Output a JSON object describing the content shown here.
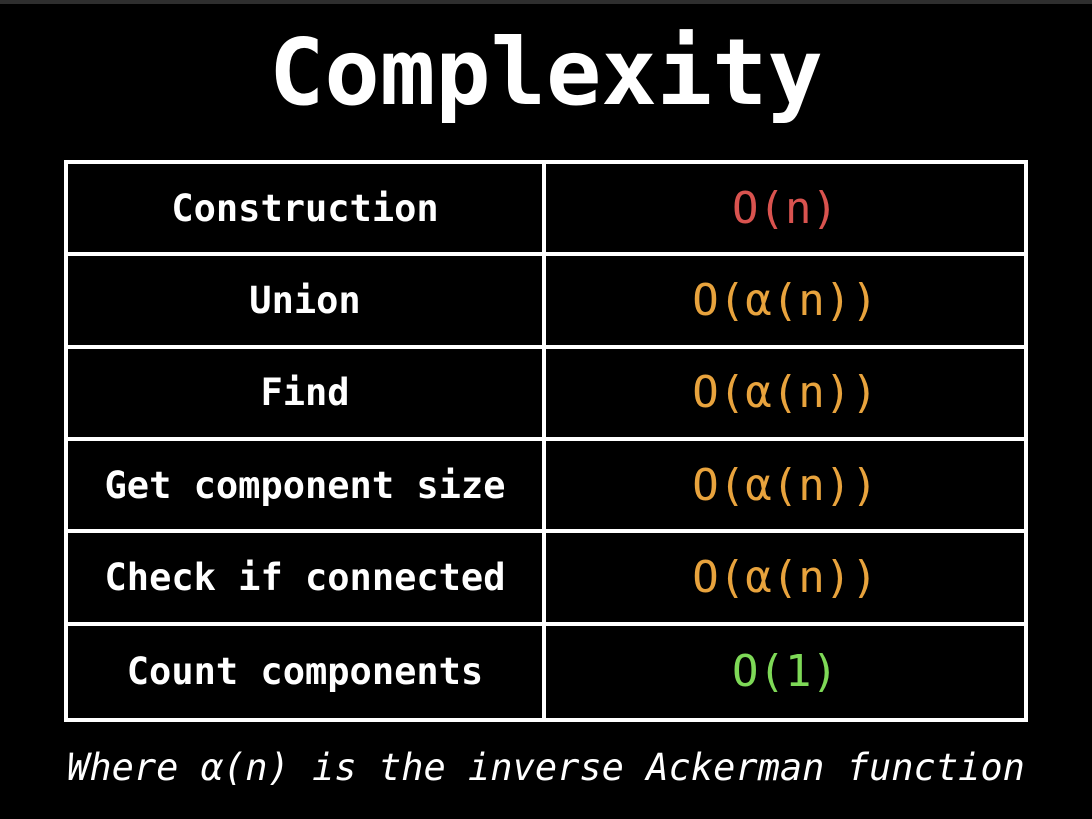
{
  "title": "Complexity",
  "rows": [
    {
      "operation": "Construction",
      "complexity": "O(n)",
      "color": "#d9534f"
    },
    {
      "operation": "Union",
      "complexity": "O(α(n))",
      "color": "#e8a33d"
    },
    {
      "operation": "Find",
      "complexity": "O(α(n))",
      "color": "#e8a33d"
    },
    {
      "operation": "Get component size",
      "complexity": "O(α(n))",
      "color": "#e8a33d"
    },
    {
      "operation": "Check if connected",
      "complexity": "O(α(n))",
      "color": "#e8a33d"
    },
    {
      "operation": "Count components",
      "complexity": "O(1)",
      "color": "#7ed957"
    }
  ],
  "footnote": "Where α(n) is the inverse Ackerman function"
}
